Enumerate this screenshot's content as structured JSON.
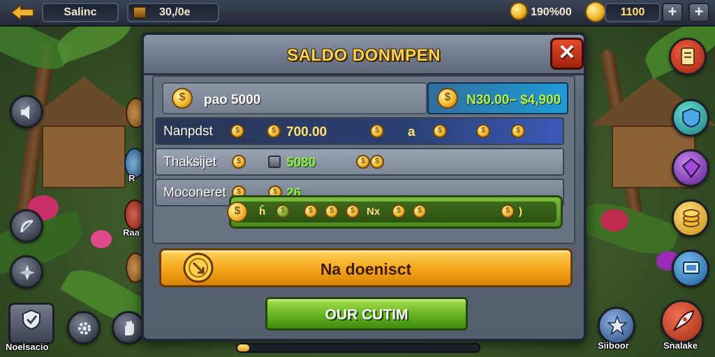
{
  "topbar": {
    "name_label": "Salinc",
    "gold_value": "30,/0e",
    "coins_value": "190%00",
    "gems_value": "1100",
    "plus_glyph": "+"
  },
  "left_buttons": {
    "bottom_caption": "Noelsacio"
  },
  "left_npc_labels": [
    "R",
    "Raa"
  ],
  "right_buttons": {
    "caption_a": "Siiboor",
    "caption_b": "Snalake"
  },
  "modal": {
    "title": "SALDO DONMPEN",
    "close_glyph": "✕",
    "balance": {
      "label": "pao 5000",
      "range": "N30.00– $4,900"
    },
    "rows": [
      {
        "label": "Nanpdst",
        "value": "700.00",
        "tag": "a",
        "style": "blue"
      },
      {
        "label": "Thaksijet",
        "value": "5080",
        "style": "grey"
      },
      {
        "label": "Moconeret",
        "value": "26",
        "style": "grey"
      }
    ],
    "reward_bar": {
      "tag_a": "ĥ",
      "tag_b": "Nx",
      "tag_c": ")"
    },
    "deposit_button": "Na doenisct",
    "ok_button": "OUR CUTIM"
  },
  "progress": {
    "fraction": 0.05
  },
  "colors": {
    "title_gold": "#ffd24a",
    "deposit_orange": "#f5a51a",
    "ok_green": "#5fae1e",
    "close_red": "#c5341a",
    "range_green_text": "#b6f04a"
  }
}
